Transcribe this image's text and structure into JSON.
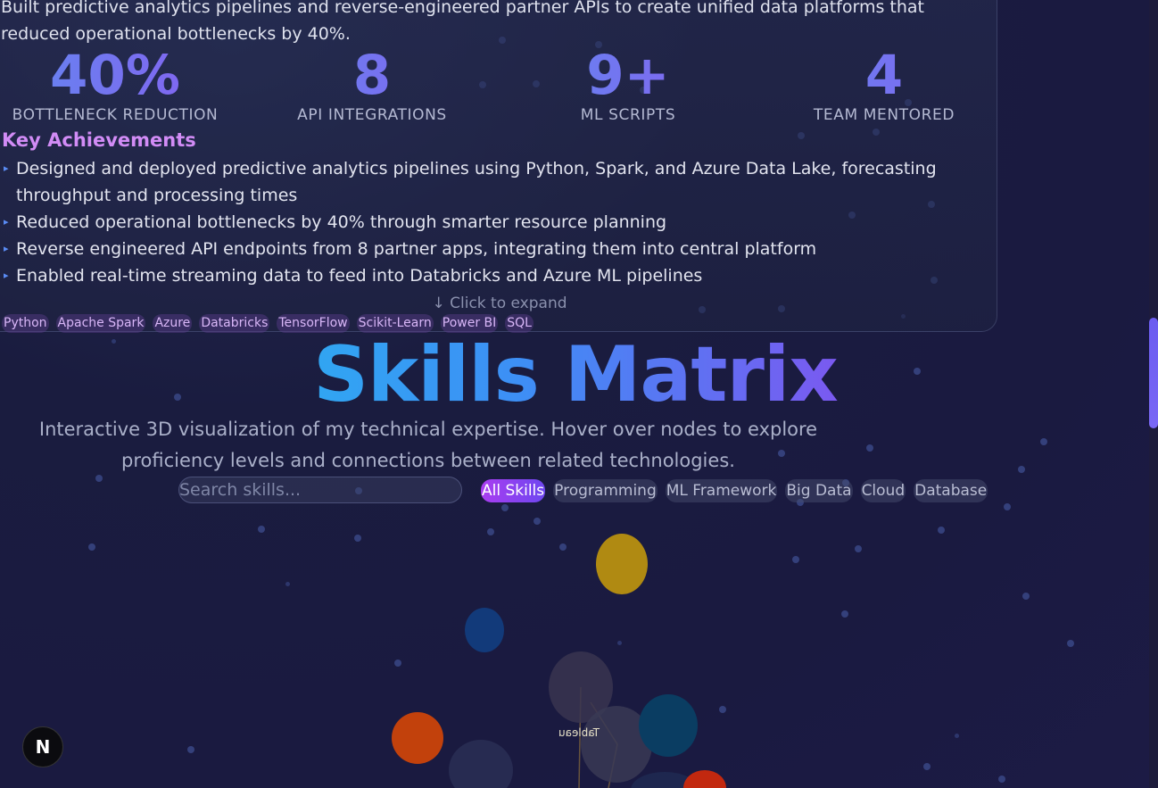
{
  "experience": {
    "summary": "Built predictive analytics pipelines and reverse-engineered partner APIs to create unified data platforms that reduced operational bottlenecks by 40%.",
    "stats": [
      {
        "value": "40%",
        "label": "BOTTLENECK REDUCTION"
      },
      {
        "value": "8",
        "label": "API INTEGRATIONS"
      },
      {
        "value": "9+",
        "label": "ML SCRIPTS"
      },
      {
        "value": "4",
        "label": "TEAM MENTORED"
      }
    ],
    "achievements_title": "Key Achievements",
    "achievements": [
      "Designed and deployed predictive analytics pipelines using Python, Spark, and Azure Data Lake, forecasting throughput and processing times",
      "Reduced operational bottlenecks by 40% through smarter resource planning",
      "Reverse engineered API endpoints from 8 partner apps, integrating them into central platform",
      "Enabled real-time streaming data to feed into Databricks and Azure ML pipelines"
    ],
    "bullet_glyph": "▸",
    "expand_label": "↓ Click to expand",
    "tags": [
      "Python",
      "Apache Spark",
      "Azure",
      "Databricks",
      "TensorFlow",
      "Scikit-Learn",
      "Power BI",
      "SQL"
    ]
  },
  "skills": {
    "title": "Skills Matrix",
    "subtitle": "Interactive 3D visualization of my technical expertise. Hover over nodes to explore proficiency levels and connections between related technologies.",
    "search_placeholder": "Search skills...",
    "filters": [
      {
        "label": "All Skills",
        "active": true
      },
      {
        "label": "Programming",
        "active": false
      },
      {
        "label": "ML Framework",
        "active": false
      },
      {
        "label": "Big Data",
        "active": false
      },
      {
        "label": "Cloud",
        "active": false
      },
      {
        "label": "Database",
        "active": false
      }
    ],
    "node_label": "Tableau",
    "node_colors": {
      "yellow": "#b08a12",
      "blue": "#123a7a",
      "orange": "#c2410c",
      "teal": "#0a3d62",
      "gray": "#3a3550",
      "red": "#c2280f"
    }
  },
  "badge": {
    "letter": "N"
  },
  "accent": {
    "purple": "#8a5cf0",
    "cyan": "#1ec8ee"
  }
}
